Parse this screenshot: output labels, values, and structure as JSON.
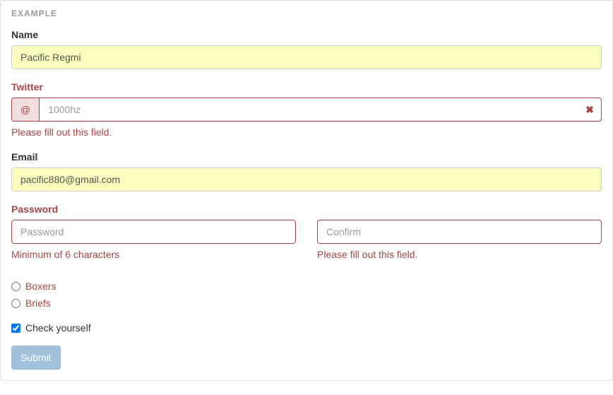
{
  "panel": {
    "heading": "EXAMPLE"
  },
  "name": {
    "label": "Name",
    "value": "Pacific Regmi"
  },
  "twitter": {
    "label": "Twitter",
    "addon": "@",
    "placeholder": "1000hz",
    "value": "",
    "error": "Please fill out this field."
  },
  "email": {
    "label": "Email",
    "value": "pacific880@gmail.com"
  },
  "password": {
    "label": "Password",
    "placeholder": "Password",
    "value": "",
    "error": "Minimum of 6 characters"
  },
  "confirm": {
    "placeholder": "Confirm",
    "value": "",
    "error": "Please fill out this field."
  },
  "underwear": {
    "option1": "Boxers",
    "option2": "Briefs"
  },
  "check": {
    "label": "Check yourself",
    "checked": true
  },
  "submit": {
    "label": "Submit"
  }
}
